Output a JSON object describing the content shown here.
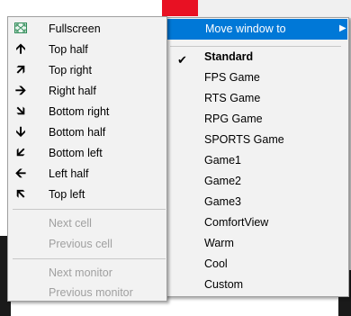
{
  "left_menu": {
    "items": [
      {
        "label": "Fullscreen",
        "icon": "fullscreen-icon",
        "enabled": true
      },
      {
        "label": "Top half",
        "icon": "arrow-up-icon",
        "enabled": true
      },
      {
        "label": "Top right",
        "icon": "arrow-up-right-icon",
        "enabled": true
      },
      {
        "label": "Right half",
        "icon": "arrow-right-icon",
        "enabled": true
      },
      {
        "label": "Bottom right",
        "icon": "arrow-down-right-icon",
        "enabled": true
      },
      {
        "label": "Bottom half",
        "icon": "arrow-down-icon",
        "enabled": true
      },
      {
        "label": "Bottom left",
        "icon": "arrow-down-left-icon",
        "enabled": true
      },
      {
        "label": "Left half",
        "icon": "arrow-left-icon",
        "enabled": true
      },
      {
        "label": "Top left",
        "icon": "arrow-up-left-icon",
        "enabled": true
      }
    ],
    "cell_items": [
      {
        "label": "Next cell",
        "enabled": false
      },
      {
        "label": "Previous cell",
        "enabled": false
      }
    ],
    "monitor_items": [
      {
        "label": "Next monitor",
        "enabled": false
      },
      {
        "label": "Previous monitor",
        "enabled": false
      }
    ]
  },
  "right_menu": {
    "header": {
      "label": "Move window to",
      "submenu_icon": "submenu-arrow-icon",
      "highlighted": true
    },
    "checked_item": "Standard",
    "items": [
      {
        "label": "Standard",
        "checked": true,
        "bold": true
      },
      {
        "label": "FPS Game"
      },
      {
        "label": "RTS Game"
      },
      {
        "label": "RPG Game"
      },
      {
        "label": "SPORTS Game"
      },
      {
        "label": "Game1"
      },
      {
        "label": "Game2"
      },
      {
        "label": "Game3"
      },
      {
        "label": "ComfortView"
      },
      {
        "label": "Warm"
      },
      {
        "label": "Cool"
      },
      {
        "label": "Custom"
      }
    ]
  },
  "colors": {
    "highlight": "#0078d7",
    "menu_bg": "#f2f2f2",
    "disabled_text": "#a0a0a0",
    "close_red": "#e81123"
  }
}
